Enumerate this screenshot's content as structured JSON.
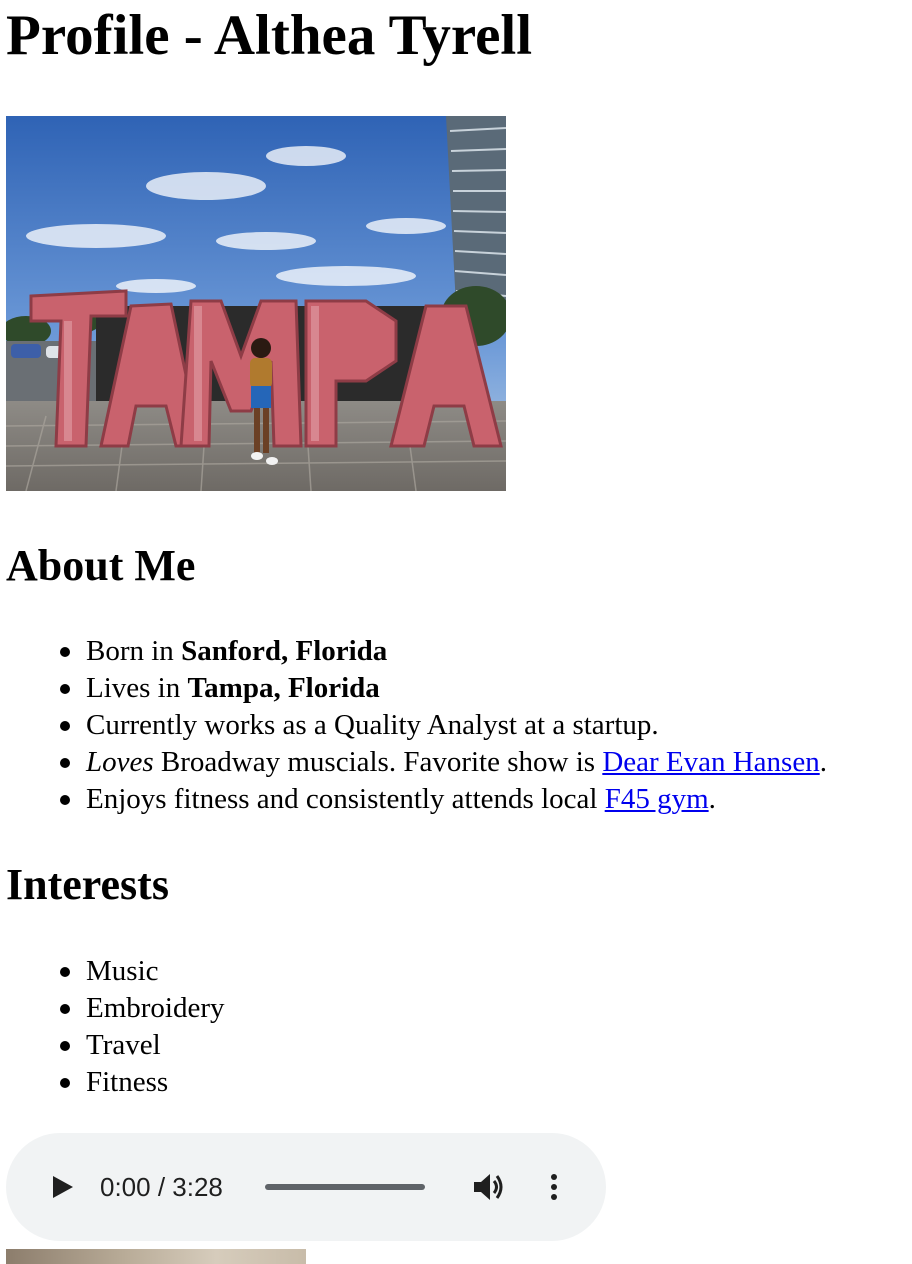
{
  "page": {
    "title": "Profile - Althea Tyrell",
    "photo": {
      "description_icon": "photo-tampa-sign",
      "sign_text": "TAMPA"
    }
  },
  "about": {
    "heading": "About Me",
    "items": [
      {
        "prefix": "Born in ",
        "bold": "Sanford, Florida"
      },
      {
        "prefix": "Lives in ",
        "bold": "Tampa, Florida"
      },
      {
        "text": "Currently works as a Quality Analyst at a startup."
      },
      {
        "italic": "Loves",
        "middle": " Broadway muscials. Favorite show is ",
        "link": "Dear Evan Hansen",
        "suffix": "."
      },
      {
        "prefix": "Enjoys fitness and consistently attends local ",
        "link": "F45 gym",
        "suffix": "."
      }
    ]
  },
  "interests": {
    "heading": "Interests",
    "items": [
      "Music",
      "Embroidery",
      "Travel",
      "Fitness"
    ]
  },
  "audio": {
    "time_display": "0:00 / 3:28",
    "progress": 0,
    "icons": [
      "play-icon",
      "volume-icon",
      "more-options-icon"
    ]
  },
  "colors": {
    "link": "#0000ee",
    "audio_bg": "#f1f3f4",
    "sign": "#c9626d"
  }
}
